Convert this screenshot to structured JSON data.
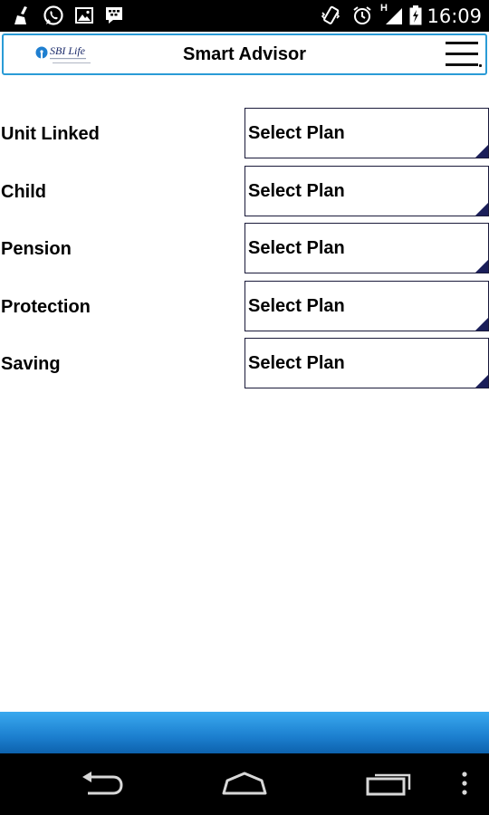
{
  "status_bar": {
    "time": "16:09",
    "network_type": "H",
    "icons": [
      "cleaner-icon",
      "whatsapp-icon",
      "gallery-icon",
      "bbm-icon",
      "vibrate-icon",
      "alarm-icon",
      "signal-icon",
      "battery-icon"
    ]
  },
  "header": {
    "logo_text": "SBI Life",
    "title": "Smart Advisor"
  },
  "categories": [
    {
      "label": "Unit Linked",
      "select_value": "Select Plan"
    },
    {
      "label": "Child",
      "select_value": "Select Plan"
    },
    {
      "label": "Pension",
      "select_value": "Select Plan"
    },
    {
      "label": "Protection",
      "select_value": "Select Plan"
    },
    {
      "label": "Saving",
      "select_value": "Select Plan"
    }
  ],
  "colors": {
    "header_border": "#2a9bd6",
    "footer_top": "#39a9ef",
    "footer_bottom": "#0d62ad",
    "select_corner": "#1b1f5a"
  },
  "nav_bar": {
    "buttons": [
      "back-icon",
      "home-icon",
      "recent-apps-icon",
      "overflow-menu-icon"
    ]
  }
}
